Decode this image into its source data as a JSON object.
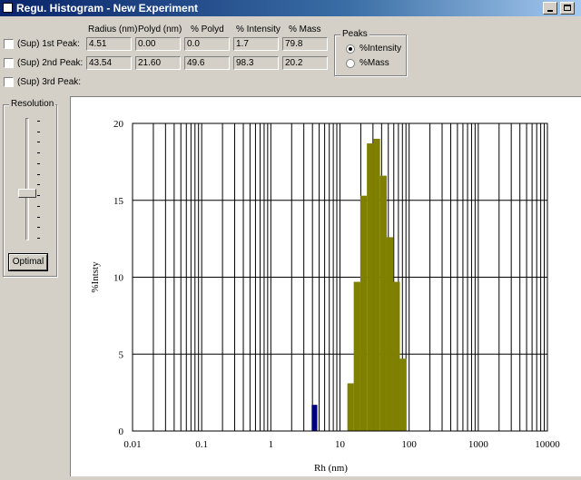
{
  "window": {
    "title": "Regu. Histogram - New Experiment"
  },
  "peaks_table": {
    "headers": [
      "Radius (nm)",
      "Polyd (nm)",
      "% Polyd",
      "% Intensity",
      "% Mass"
    ],
    "rows": [
      {
        "label": "(Sup)  1st Peak:",
        "checked": false,
        "values": [
          "4.51",
          "0.00",
          "0.0",
          "1.7",
          "79.8"
        ]
      },
      {
        "label": "(Sup)  2nd Peak:",
        "checked": false,
        "values": [
          "43.54",
          "21.60",
          "49.6",
          "98.3",
          "20.2"
        ]
      },
      {
        "label": "(Sup)  3rd Peak:",
        "checked": false,
        "values": []
      }
    ]
  },
  "peaks_group": {
    "label": "Peaks",
    "options": [
      {
        "label": "%Intensity",
        "selected": true
      },
      {
        "label": "%Mass",
        "selected": false
      }
    ]
  },
  "resolution": {
    "label": "Resolution",
    "level": 0.62,
    "button_label": "Optimal"
  },
  "chart_data": {
    "type": "bar",
    "xscale": "log",
    "xlabel": "Rh (nm)",
    "ylabel": "%Intsty",
    "xlim": [
      0.01,
      10000
    ],
    "ylim": [
      0,
      20
    ],
    "xticks": [
      "0.01",
      "0.1",
      "1",
      "10",
      "100",
      "1000",
      "10000"
    ],
    "yticks": [
      "0",
      "5",
      "10",
      "15",
      "20"
    ],
    "grid": true,
    "series": [
      {
        "color": "#00007f",
        "bars": [
          {
            "x0": 3.9,
            "x1": 4.7,
            "y": 1.7
          }
        ]
      },
      {
        "color": "#7f7f00",
        "bars": [
          {
            "x0": 12.8,
            "x1": 15.8,
            "y": 3.1
          },
          {
            "x0": 15.8,
            "x1": 19.7,
            "y": 9.7
          },
          {
            "x0": 19.7,
            "x1": 24.5,
            "y": 15.3
          },
          {
            "x0": 24.5,
            "x1": 30.5,
            "y": 18.7
          },
          {
            "x0": 30.5,
            "x1": 38.0,
            "y": 19.0
          },
          {
            "x0": 38.0,
            "x1": 47.4,
            "y": 16.6
          },
          {
            "x0": 47.4,
            "x1": 59.0,
            "y": 12.6
          },
          {
            "x0": 59.0,
            "x1": 73.5,
            "y": 9.7
          },
          {
            "x0": 73.5,
            "x1": 91.0,
            "y": 4.7
          }
        ]
      }
    ]
  }
}
